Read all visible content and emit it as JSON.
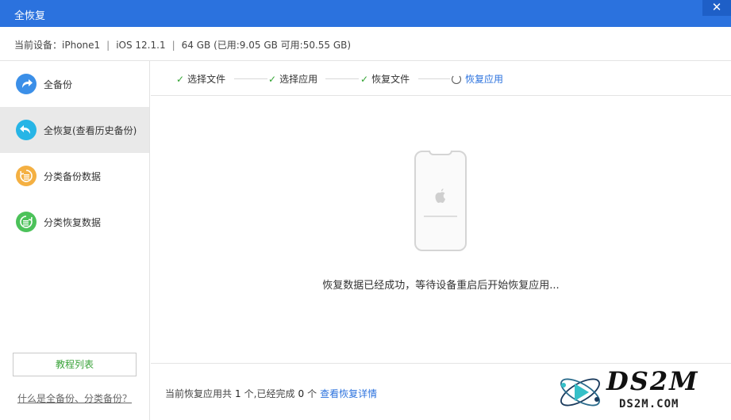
{
  "window": {
    "title": "全恢复",
    "close_label": "✕"
  },
  "device_bar": {
    "label": "当前设备：",
    "device": "iPhone1",
    "os": "iOS 12.1.1",
    "storage": "64 GB (已用:9.05 GB 可用:50.55 GB)",
    "separator": "|"
  },
  "sidebar": {
    "items": [
      {
        "label": "全备份",
        "icon": "full-backup-icon",
        "color": "#3b8fe8",
        "active": false
      },
      {
        "label": "全恢复(查看历史备份)",
        "icon": "full-restore-icon",
        "color": "#27b5e6",
        "active": true
      },
      {
        "label": "分类备份数据",
        "icon": "category-backup-icon",
        "color": "#f4b042",
        "active": false
      },
      {
        "label": "分类恢复数据",
        "icon": "category-restore-icon",
        "color": "#4cc25a",
        "active": false
      }
    ],
    "tutorial_button": "教程列表",
    "help_link": "什么是全备份、分类备份？"
  },
  "steps": [
    {
      "label": "选择文件",
      "state": "done"
    },
    {
      "label": "选择应用",
      "state": "done"
    },
    {
      "label": "恢复文件",
      "state": "done"
    },
    {
      "label": "恢复应用",
      "state": "in-progress"
    }
  ],
  "main": {
    "status_message": "恢复数据已经成功，等待设备重启后开始恢复应用..."
  },
  "footer": {
    "prefix": "当前恢复应用共",
    "total": "1",
    "middle": "个,已经完成",
    "done": "0",
    "suffix": "个",
    "detail_link": "查看恢复详情"
  },
  "watermark": {
    "big": "DS2M",
    "small": "DS2M.COM"
  },
  "colors": {
    "title_bar": "#2b72de",
    "accent": "#2b72de",
    "check": "#31a331"
  }
}
